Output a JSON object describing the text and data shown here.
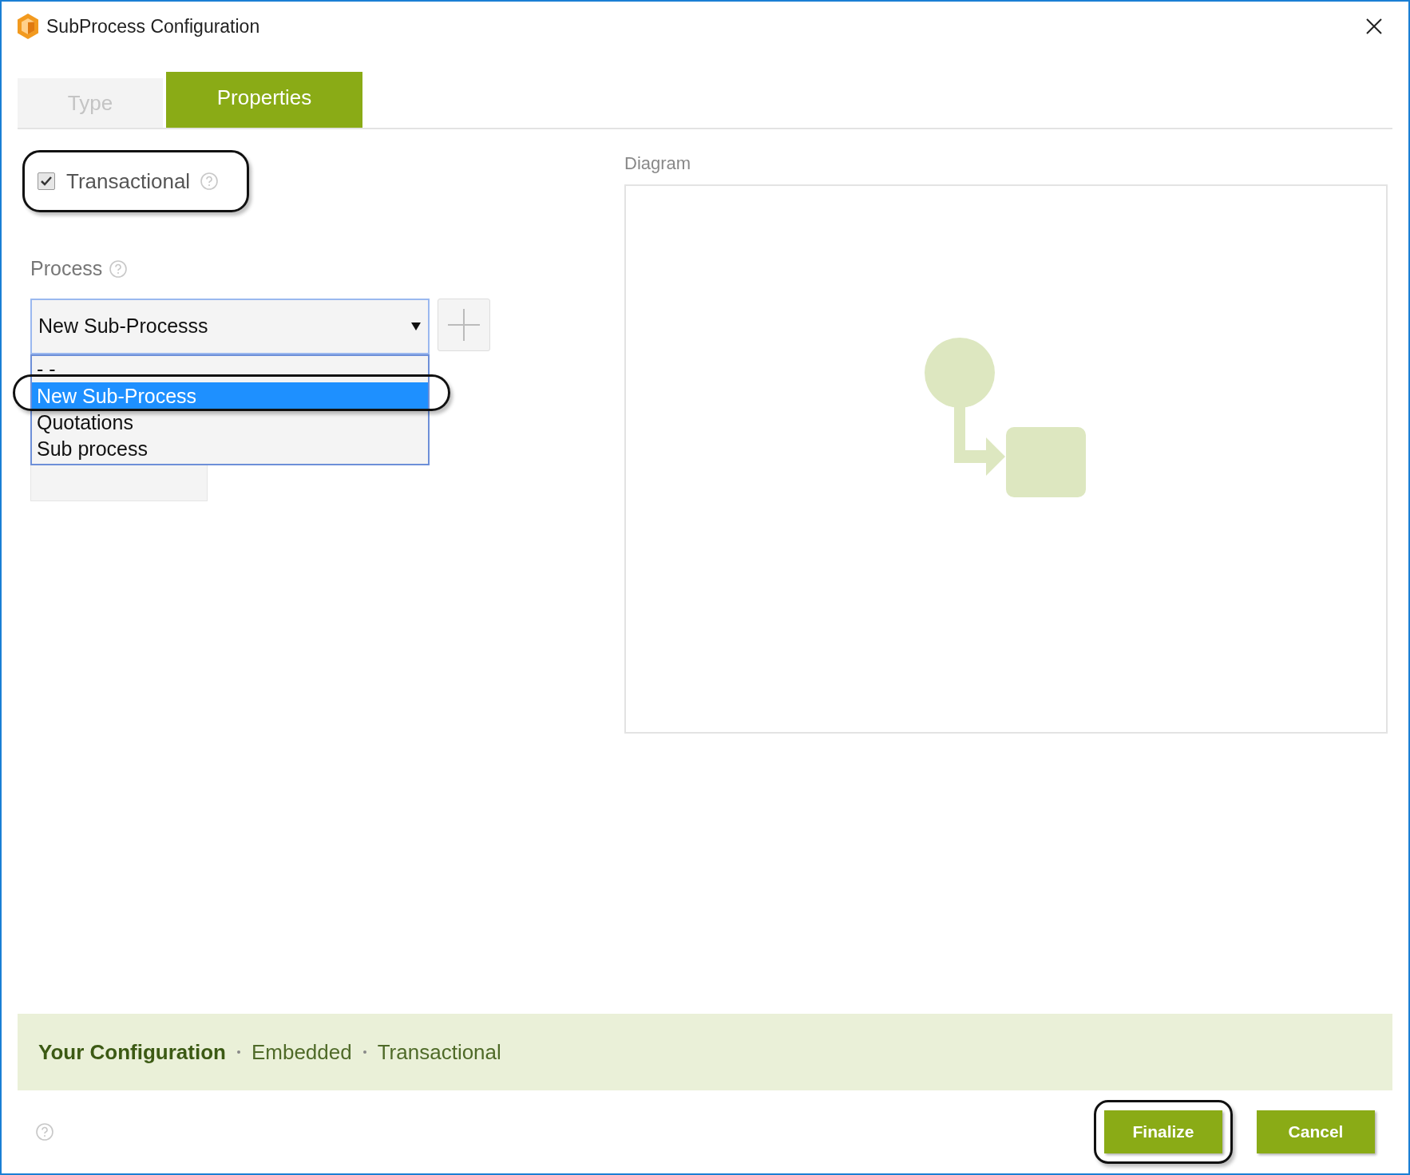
{
  "window": {
    "title": "SubProcess Configuration"
  },
  "tabs": [
    {
      "label": "Type",
      "selected": false
    },
    {
      "label": "Properties",
      "selected": true
    }
  ],
  "transactional": {
    "label": "Transactional",
    "checked": true,
    "highlighted": true
  },
  "process": {
    "label": "Process",
    "value": "New Sub-Processs",
    "expanded": true,
    "options": [
      {
        "label": "- -",
        "selected": false,
        "highlighted": false
      },
      {
        "label": "New Sub-Process",
        "selected": true,
        "highlighted": true
      },
      {
        "label": "Quotations",
        "selected": false,
        "highlighted": false
      },
      {
        "label": "Sub process",
        "selected": false,
        "highlighted": false
      }
    ]
  },
  "diagram": {
    "label": "Diagram"
  },
  "configuration": {
    "title": "Your Configuration",
    "items": [
      "Embedded",
      "Transactional"
    ]
  },
  "buttons": [
    {
      "label": "Finalize",
      "highlighted": true
    },
    {
      "label": "Cancel",
      "highlighted": false
    }
  ]
}
